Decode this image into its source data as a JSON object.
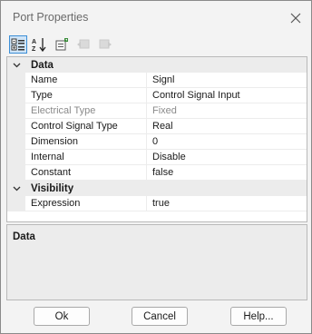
{
  "window": {
    "title": "Port Properties"
  },
  "toolbar": {
    "buttons": [
      {
        "icon": "categorized-view-icon",
        "active": true
      },
      {
        "icon": "alphabetical-sort-icon",
        "active": false
      },
      {
        "icon": "property-pages-icon",
        "active": false
      },
      {
        "icon": "back-icon",
        "active": false
      },
      {
        "icon": "forward-icon",
        "active": false
      }
    ]
  },
  "grid": {
    "categories": [
      {
        "label": "Data",
        "properties": [
          {
            "name": "Name",
            "value": "Signl",
            "disabled": false
          },
          {
            "name": "Type",
            "value": "Control Signal Input",
            "disabled": false
          },
          {
            "name": "Electrical Type",
            "value": "Fixed",
            "disabled": true
          },
          {
            "name": "Control Signal Type",
            "value": "Real",
            "disabled": false
          },
          {
            "name": "Dimension",
            "value": "0",
            "disabled": false
          },
          {
            "name": "Internal",
            "value": "Disable",
            "disabled": false
          },
          {
            "name": "Constant",
            "value": "false",
            "disabled": false
          }
        ]
      },
      {
        "label": "Visibility",
        "properties": [
          {
            "name": "Expression",
            "value": "true",
            "disabled": false
          }
        ]
      }
    ]
  },
  "description": {
    "heading": "Data"
  },
  "buttons": {
    "ok": "Ok",
    "cancel": "Cancel",
    "help": "Help..."
  }
}
